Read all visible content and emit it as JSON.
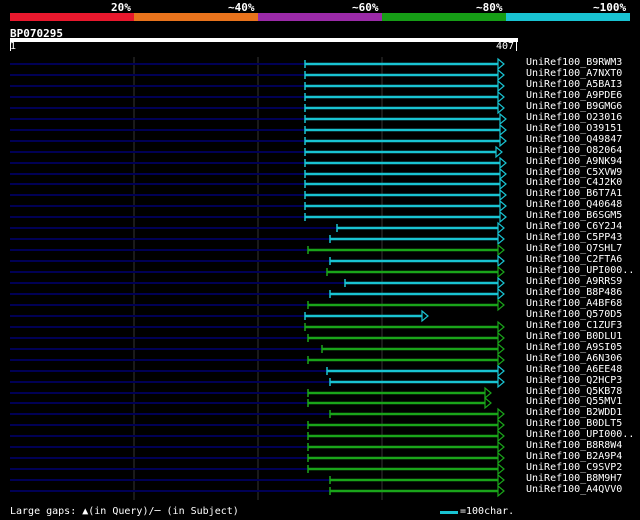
{
  "legend": {
    "segments": [
      {
        "label": "20%",
        "color": "#e8182d"
      },
      {
        "label": "~40%",
        "color": "#e8731c"
      },
      {
        "label": "~60%",
        "color": "#9b2aa8"
      },
      {
        "label": "~80%",
        "color": "#169d16"
      },
      {
        "label": "~100%",
        "color": "#19c3d2"
      }
    ]
  },
  "query": {
    "name": "BP070295",
    "start": "1",
    "end": "407"
  },
  "colors": {
    "low": "#000055",
    "cyan": "#19c3d2",
    "green": "#1aa41a",
    "grid": "#333333"
  },
  "hits": [
    {
      "name": "UniRef100_B9RWM3",
      "start": 305,
      "end": 498,
      "color": "cyan"
    },
    {
      "name": "UniRef100_A7NXT0",
      "start": 305,
      "end": 498,
      "color": "cyan"
    },
    {
      "name": "UniRef100_A5BAI3",
      "start": 305,
      "end": 498,
      "color": "cyan"
    },
    {
      "name": "UniRef100_A9PDE6",
      "start": 305,
      "end": 498,
      "color": "cyan"
    },
    {
      "name": "UniRef100_B9GMG6",
      "start": 305,
      "end": 498,
      "color": "cyan"
    },
    {
      "name": "UniRef100_O23016",
      "start": 305,
      "end": 500,
      "color": "cyan"
    },
    {
      "name": "UniRef100_O39151",
      "start": 305,
      "end": 500,
      "color": "cyan"
    },
    {
      "name": "UniRef100_Q49847",
      "start": 305,
      "end": 500,
      "color": "cyan"
    },
    {
      "name": "UniRef100_O82064",
      "start": 305,
      "end": 496,
      "color": "cyan"
    },
    {
      "name": "UniRef100_A9NK94",
      "start": 305,
      "end": 500,
      "color": "cyan"
    },
    {
      "name": "UniRef100_C5XVW9",
      "start": 305,
      "end": 500,
      "color": "cyan"
    },
    {
      "name": "UniRef100_C4J2K0",
      "start": 305,
      "end": 500,
      "color": "cyan"
    },
    {
      "name": "UniRef100_B6T7A1",
      "start": 305,
      "end": 500,
      "color": "cyan"
    },
    {
      "name": "UniRef100_Q40648",
      "start": 305,
      "end": 500,
      "color": "cyan"
    },
    {
      "name": "UniRef100_B6SGM5",
      "start": 305,
      "end": 500,
      "color": "cyan"
    },
    {
      "name": "UniRef100_C6Y2J4",
      "start": 337,
      "end": 498,
      "color": "cyan"
    },
    {
      "name": "UniRef100_C5PP43",
      "start": 330,
      "end": 498,
      "color": "cyan"
    },
    {
      "name": "UniRef100_Q7SHL7",
      "start": 308,
      "end": 498,
      "color": "green"
    },
    {
      "name": "UniRef100_C2FTA6",
      "start": 330,
      "end": 498,
      "color": "cyan"
    },
    {
      "name": "UniRef100_UPI000..",
      "start": 327,
      "end": 498,
      "color": "green"
    },
    {
      "name": "UniRef100_A9RRS9",
      "start": 345,
      "end": 498,
      "color": "cyan"
    },
    {
      "name": "UniRef100_B8P486",
      "start": 330,
      "end": 498,
      "color": "cyan"
    },
    {
      "name": "UniRef100_A4BF68",
      "start": 308,
      "end": 498,
      "color": "green"
    },
    {
      "name": "UniRef100_Q570D5",
      "start": 305,
      "end": 422,
      "color": "cyan"
    },
    {
      "name": "UniRef100_C1ZUF3",
      "start": 305,
      "end": 498,
      "color": "green"
    },
    {
      "name": "UniRef100_B0DLU1",
      "start": 308,
      "end": 498,
      "color": "green"
    },
    {
      "name": "UniRef100_A9SI05",
      "start": 322,
      "end": 498,
      "color": "green"
    },
    {
      "name": "UniRef100_A6N306",
      "start": 308,
      "end": 498,
      "color": "green"
    },
    {
      "name": "UniRef100_A6EE48",
      "start": 327,
      "end": 498,
      "color": "cyan"
    },
    {
      "name": "UniRef100_Q2HCP3",
      "start": 330,
      "end": 498,
      "color": "cyan"
    },
    {
      "name": "UniRef100_Q5KB78",
      "start": 308,
      "end": 485,
      "color": "green"
    },
    {
      "name": "UniRef100_Q55MV1",
      "start": 308,
      "end": 485,
      "color": "green"
    },
    {
      "name": "UniRef100_B2WDD1",
      "start": 330,
      "end": 498,
      "color": "green"
    },
    {
      "name": "UniRef100_B0DLT5",
      "start": 308,
      "end": 498,
      "color": "green"
    },
    {
      "name": "UniRef100_UPI000..",
      "start": 308,
      "end": 498,
      "color": "green"
    },
    {
      "name": "UniRef100_B8R8W4",
      "start": 308,
      "end": 498,
      "color": "green"
    },
    {
      "name": "UniRef100_B2A9P4",
      "start": 308,
      "end": 498,
      "color": "green"
    },
    {
      "name": "UniRef100_C9SVP2",
      "start": 308,
      "end": 498,
      "color": "green"
    },
    {
      "name": "UniRef100_B8M9H7",
      "start": 330,
      "end": 498,
      "color": "green"
    },
    {
      "name": "UniRef100_A4QVV0",
      "start": 330,
      "end": 498,
      "color": "green"
    }
  ],
  "footer": {
    "gaps_text": "Large gaps: ▲(in Query)/─ (in Subject)",
    "scale_text": "=100char."
  }
}
